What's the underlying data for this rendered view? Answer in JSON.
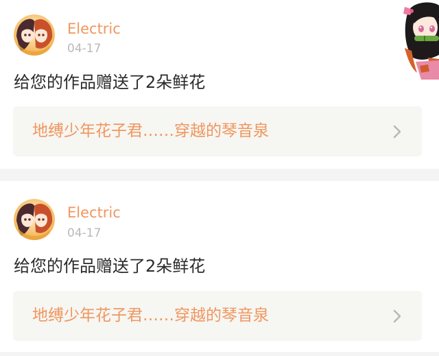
{
  "colors": {
    "accent": "#f0965e",
    "date": "#b9b9b9",
    "text": "#2a2a2a",
    "link_bg": "#f6f6f2",
    "separator": "#f4f4f4"
  },
  "notifications": [
    {
      "avatar_icon": "anime-avatar-icon",
      "username": "Electric",
      "date": "04-17",
      "message": "给您的作品赠送了2朵鲜花",
      "link_title": "地缚少年花子君……穿越的琴音泉",
      "chevron_icon": "chevron-right-icon"
    },
    {
      "avatar_icon": "anime-avatar-icon",
      "username": "Electric",
      "date": "04-17",
      "message": "给您的作品赠送了2朵鲜花",
      "link_title": "地缚少年花子君……穿越的琴音泉",
      "chevron_icon": "chevron-right-icon"
    }
  ],
  "decoration": {
    "sticker_icon": "anime-girl-sticker-icon"
  }
}
